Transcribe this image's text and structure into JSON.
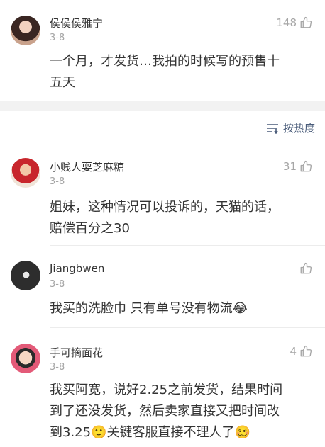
{
  "top_comment": {
    "user": "侯侯侯雅宁",
    "date": "3-8",
    "likes": "148",
    "text": "一个月，才发货…我拍的时候写的预售十\n五天"
  },
  "sort": {
    "label": "按热度",
    "icon": "sort-lines-icon"
  },
  "comments": [
    {
      "user": "小贱人耍芝麻糖",
      "date": "3-8",
      "likes": "31",
      "text": "姐妹，这种情况可以投诉的，天猫的话，\n赔偿百分之30"
    },
    {
      "user": "Jiangbwen",
      "date": "3-8",
      "likes": "",
      "text": "我买的洗脸巾 只有单号没有物流😂"
    },
    {
      "user": "手可摘面花",
      "date": "3-8",
      "likes": "4",
      "text": "我买阿宽，说好2.25之前发货，结果时间\n到了还没发货，然后卖家直接又把时间改\n到3.25🙂关键客服直接不理人了🥴"
    }
  ],
  "colors": {
    "link": "#4a5c7a",
    "muted": "#a6a6a6",
    "text": "#333333",
    "band": "#f2f2f2"
  }
}
